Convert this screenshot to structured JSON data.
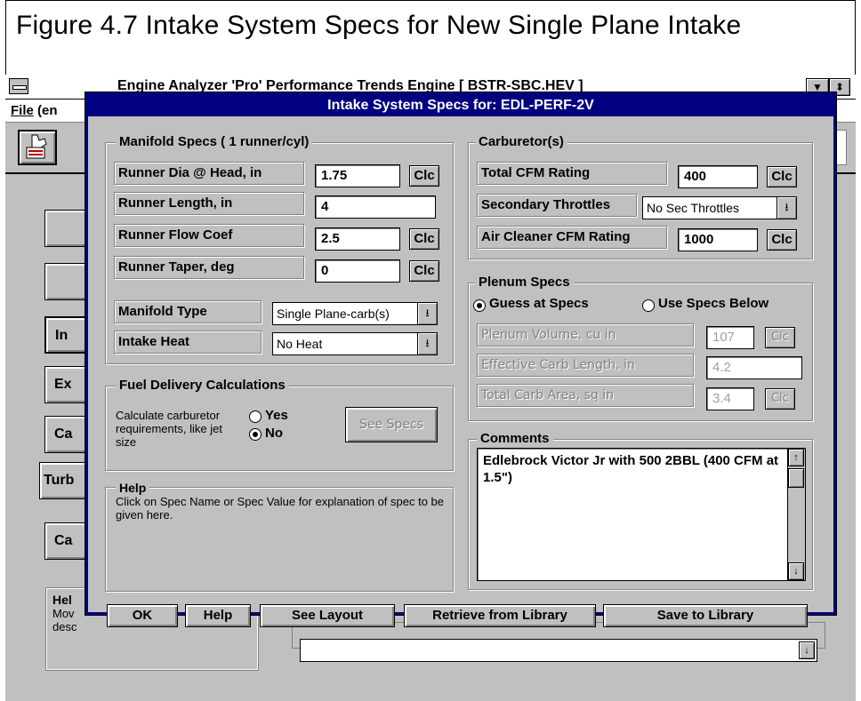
{
  "figure_caption": "Figure 4.7  Intake System Specs for New Single Plane Intake",
  "background_window": {
    "title": "Engine Analyzer 'Pro'   Performance Trends    Engine [ BSTR-SBC.HEV ]",
    "menu_file": "File",
    "menu_rest": " (en",
    "side_buttons": [
      "",
      "",
      "In",
      "Ex",
      "Ca",
      "Turb",
      "Ca"
    ],
    "help_title": "Hel",
    "help_line1": "Mov",
    "help_line2": "desc"
  },
  "dialog": {
    "title": "Intake System Specs for: EDL-PERF-2V",
    "manifold": {
      "group_label": "Manifold Specs ( 1 runner/cyl)",
      "rows": [
        {
          "label": "Runner Dia @ Head, in",
          "value": "1.75",
          "clc": "Clc"
        },
        {
          "label": "Runner Length, in",
          "value": "4"
        },
        {
          "label": "Runner Flow Coef",
          "value": "2.5",
          "clc": "Clc"
        },
        {
          "label": "Runner Taper, deg",
          "value": "0",
          "clc": "Clc"
        }
      ],
      "type_label": "Manifold Type",
      "type_value": "Single Plane-carb(s)",
      "heat_label": "Intake Heat",
      "heat_value": "No Heat"
    },
    "fuel": {
      "group_label": "Fuel Delivery Calculations",
      "description": "Calculate carburetor requirements, like jet size",
      "yes": "Yes",
      "no": "No",
      "selected": "No",
      "see_specs": "See Specs"
    },
    "help": {
      "group_label": "Help",
      "text": "Click on Spec Name or Spec Value for explanation of spec to be given here."
    },
    "carb": {
      "group_label": "Carburetor(s)",
      "cfm_label": "Total CFM Rating",
      "cfm_value": "400",
      "clc": "Clc",
      "sec_label": "Secondary Throttles",
      "sec_value": "No Sec Throttles",
      "air_label": "Air Cleaner CFM Rating",
      "air_value": "1000"
    },
    "plenum": {
      "group_label": "Plenum Specs",
      "guess": "Guess at Specs",
      "use": "Use Specs Below",
      "selected": "Guess at Specs",
      "rows": [
        {
          "label": "Plenum Volume, cu in",
          "value": "107",
          "clc": "Clc"
        },
        {
          "label": "Effective Carb Length, in",
          "value": "4.2"
        },
        {
          "label": "Total Carb Area, sq in",
          "value": "3.4",
          "clc": "Clc"
        }
      ]
    },
    "comments": {
      "group_label": "Comments",
      "text": "Edlebrock Victor Jr with 500 2BBL (400 CFM at 1.5\")"
    },
    "buttons": {
      "ok": "OK",
      "help": "Help",
      "see_layout": "See Layout",
      "retrieve": "Retrieve from Library",
      "save": "Save to Library"
    }
  }
}
